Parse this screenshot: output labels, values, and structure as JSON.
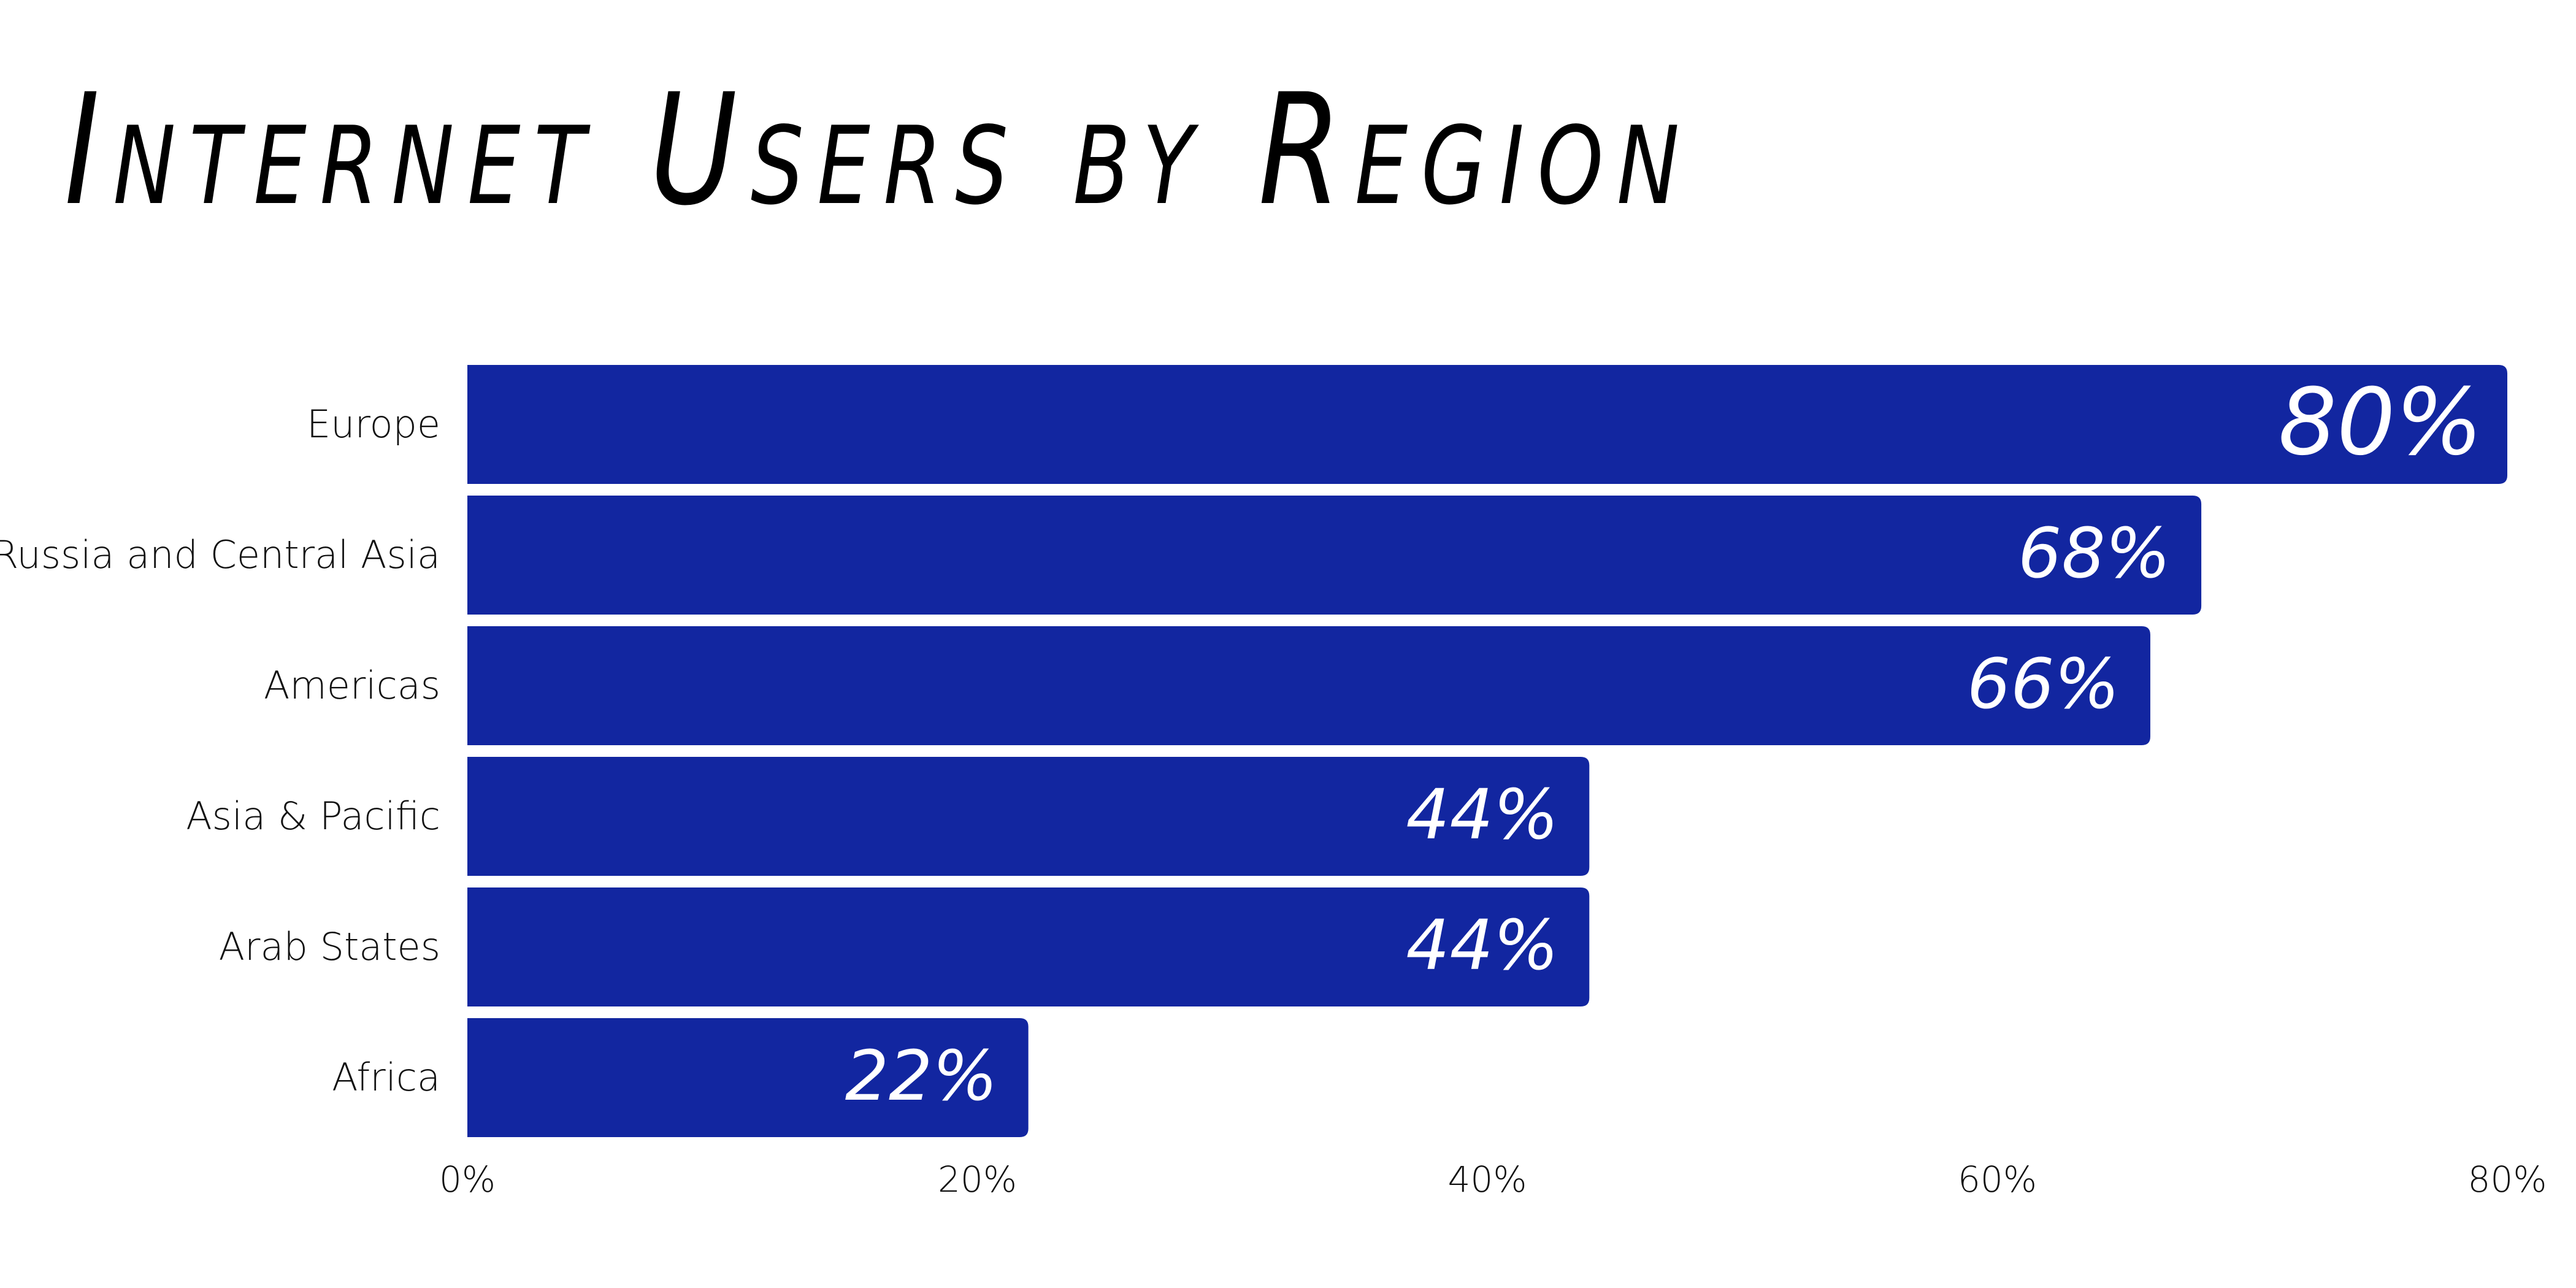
{
  "colors": {
    "bar": "#1226A0",
    "value_text": "#FFFFFF",
    "axis_text": "#111111",
    "background": "#FFFFFF"
  },
  "chart_data": {
    "type": "bar",
    "orientation": "horizontal",
    "title": "Internet Users by Region",
    "xlabel": "",
    "ylabel": "",
    "categories": [
      "Europe",
      "Russia and Central Asia",
      "Americas",
      "Asia & Pacific",
      "Arab States",
      "Africa"
    ],
    "values": [
      80,
      68,
      66,
      44,
      44,
      22
    ],
    "value_labels": [
      "80%",
      "68%",
      "66%",
      "44%",
      "44%",
      "22%"
    ],
    "xlim": [
      0,
      80
    ],
    "xticks": [
      0,
      20,
      40,
      60,
      80
    ],
    "xtick_labels": [
      "0%",
      "20%",
      "40%",
      "60%",
      "80%"
    ],
    "grid": false,
    "legend": "none"
  }
}
